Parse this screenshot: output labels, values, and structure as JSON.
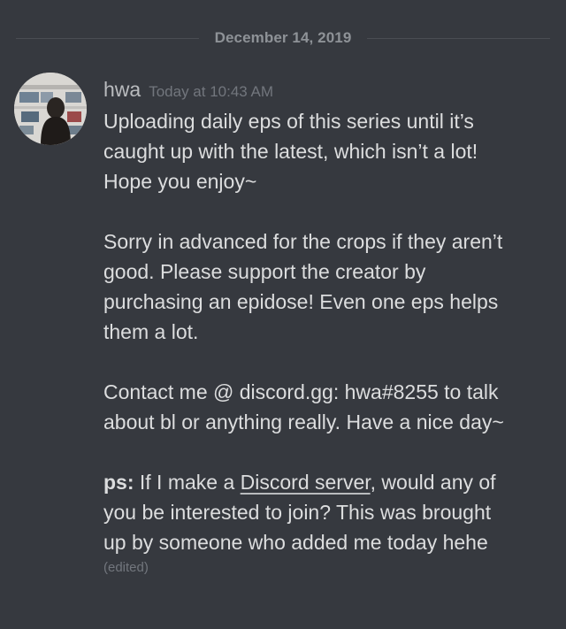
{
  "divider": {
    "date": "December 14, 2019"
  },
  "message": {
    "author": "hwa",
    "timestamp": "Today at 10:43 AM",
    "avatar_icon": "user-avatar-photo",
    "paragraph1_lines": [
      "Uploading daily eps of this series until it’s",
      "caught up with the latest, which isn’t a lot!",
      "Hope you enjoy~"
    ],
    "paragraph2_lines": [
      "Sorry in advanced for the crops if they aren’t",
      "good. Please support the creator by",
      "purchasing an epidose! Even one eps helps",
      "them a lot."
    ],
    "paragraph3_lines": [
      "Contact me @ discord.gg: hwa#8255 to talk",
      "about bl or anything really. Have a nice day~"
    ],
    "ps": {
      "label": "ps:",
      "text_before_link": " If I make a ",
      "link_text": "Discord server",
      "text_after_link": ", would any of",
      "line2": "you be interested to join? This was brought",
      "line3": "up by someone who added me today hehe"
    },
    "edited_label": "(edited)"
  },
  "colors": {
    "background": "#36393f",
    "divider_line": "#4a4d53",
    "text_primary": "#dcddde",
    "text_muted": "#72767d",
    "username": "#b9bbbe"
  }
}
